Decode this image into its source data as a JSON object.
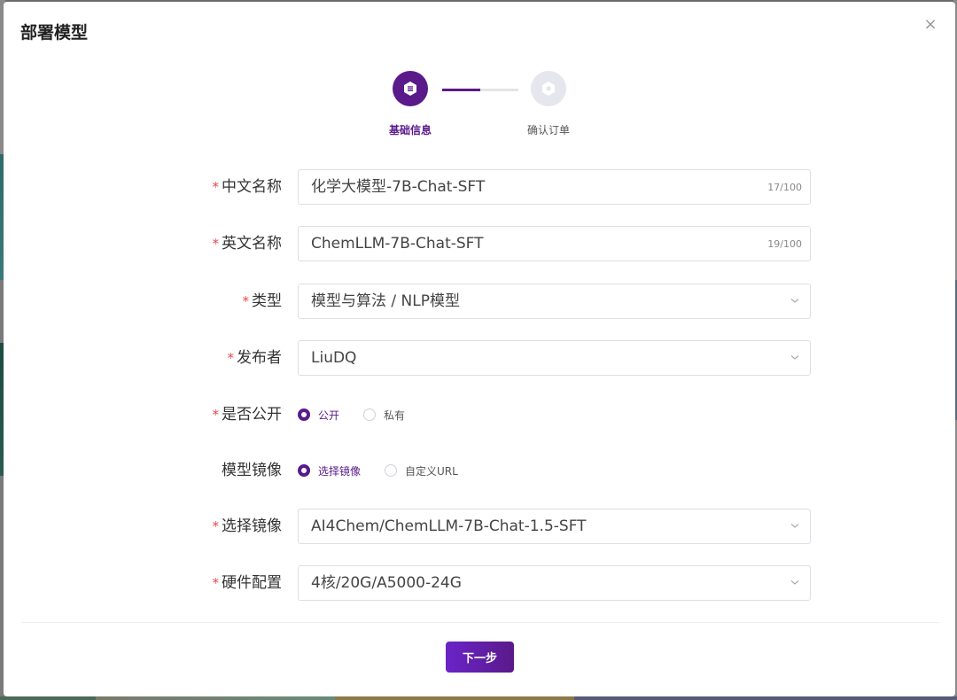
{
  "dialog": {
    "title": "部署模型",
    "close_glyph": "×"
  },
  "steps": [
    {
      "label": "基础信息",
      "state": "active"
    },
    {
      "label": "确认订单",
      "state": "pending"
    }
  ],
  "step_progress": 0.5,
  "form": {
    "cn_name": {
      "label": "中文名称",
      "required": true,
      "value": "化学大模型-7B-Chat-SFT",
      "counter": "17/100"
    },
    "en_name": {
      "label": "英文名称",
      "required": true,
      "value": "ChemLLM-7B-Chat-SFT",
      "counter": "19/100"
    },
    "type": {
      "label": "类型",
      "required": true,
      "value": "模型与算法 / NLP模型"
    },
    "publisher": {
      "label": "发布者",
      "required": true,
      "value": "LiuDQ"
    },
    "visibility": {
      "label": "是否公开",
      "required": true,
      "options": [
        "公开",
        "私有"
      ],
      "selected": 0
    },
    "image_mode": {
      "label": "模型镜像",
      "required": false,
      "options": [
        "选择镜像",
        "自定义URL"
      ],
      "selected": 0
    },
    "image": {
      "label": "选择镜像",
      "required": true,
      "value": "AI4Chem/ChemLLM-7B-Chat-1.5-SFT"
    },
    "hardware": {
      "label": "硬件配置",
      "required": true,
      "value": "4核/20G/A5000-24G"
    },
    "required_mark": "*"
  },
  "footer": {
    "next_label": "下一步"
  },
  "colors": {
    "accent": "#5a1a8a",
    "required": "#e5484d",
    "button_gradient_start": "#6a24c8"
  }
}
